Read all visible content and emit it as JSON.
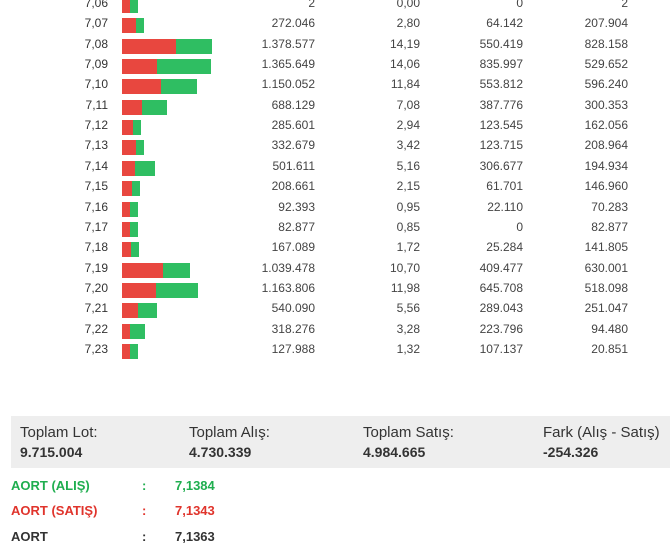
{
  "rows": [
    {
      "price": "7,06",
      "lot": "2",
      "pct": "0,00",
      "alis": "0",
      "satis": "2",
      "sell_pct": 0.0,
      "buy_pct": 0.0
    },
    {
      "price": "7,07",
      "lot": "272.046",
      "pct": "2,80",
      "alis": "64.142",
      "satis": "207.904",
      "sell_pct": 2.16,
      "buy_pct": 0.66
    },
    {
      "price": "7,08",
      "lot": "1.378.577",
      "pct": "14,19",
      "alis": "550.419",
      "satis": "828.158",
      "sell_pct": 8.52,
      "buy_pct": 5.67
    },
    {
      "price": "7,09",
      "lot": "1.365.649",
      "pct": "14,06",
      "alis": "835.997",
      "satis": "529.652",
      "sell_pct": 5.45,
      "buy_pct": 8.61
    },
    {
      "price": "7,10",
      "lot": "1.150.052",
      "pct": "11,84",
      "alis": "553.812",
      "satis": "596.240",
      "sell_pct": 6.14,
      "buy_pct": 5.7
    },
    {
      "price": "7,11",
      "lot": "688.129",
      "pct": "7,08",
      "alis": "387.776",
      "satis": "300.353",
      "sell_pct": 3.09,
      "buy_pct": 3.99
    },
    {
      "price": "7,12",
      "lot": "285.601",
      "pct": "2,94",
      "alis": "123.545",
      "satis": "162.056",
      "sell_pct": 1.67,
      "buy_pct": 1.27
    },
    {
      "price": "7,13",
      "lot": "332.679",
      "pct": "3,42",
      "alis": "123.715",
      "satis": "208.964",
      "sell_pct": 2.15,
      "buy_pct": 1.27
    },
    {
      "price": "7,14",
      "lot": "501.611",
      "pct": "5,16",
      "alis": "306.677",
      "satis": "194.934",
      "sell_pct": 2.01,
      "buy_pct": 3.16
    },
    {
      "price": "7,15",
      "lot": "208.661",
      "pct": "2,15",
      "alis": "61.701",
      "satis": "146.960",
      "sell_pct": 1.51,
      "buy_pct": 0.64
    },
    {
      "price": "7,16",
      "lot": "92.393",
      "pct": "0,95",
      "alis": "22.110",
      "satis": "70.283",
      "sell_pct": 0.72,
      "buy_pct": 0.23
    },
    {
      "price": "7,17",
      "lot": "82.877",
      "pct": "0,85",
      "alis": "0",
      "satis": "82.877",
      "sell_pct": 0.85,
      "buy_pct": 0.0
    },
    {
      "price": "7,18",
      "lot": "167.089",
      "pct": "1,72",
      "alis": "25.284",
      "satis": "141.805",
      "sell_pct": 1.46,
      "buy_pct": 0.26
    },
    {
      "price": "7,19",
      "lot": "1.039.478",
      "pct": "10,70",
      "alis": "409.477",
      "satis": "630.001",
      "sell_pct": 6.48,
      "buy_pct": 4.21
    },
    {
      "price": "7,20",
      "lot": "1.163.806",
      "pct": "11,98",
      "alis": "645.708",
      "satis": "518.098",
      "sell_pct": 5.33,
      "buy_pct": 6.65
    },
    {
      "price": "7,21",
      "lot": "540.090",
      "pct": "5,56",
      "alis": "289.043",
      "satis": "251.047",
      "sell_pct": 2.58,
      "buy_pct": 2.98
    },
    {
      "price": "7,22",
      "lot": "318.276",
      "pct": "3,28",
      "alis": "223.796",
      "satis": "94.480",
      "sell_pct": 0.97,
      "buy_pct": 2.3
    },
    {
      "price": "7,23",
      "lot": "127.988",
      "pct": "1,32",
      "alis": "107.137",
      "satis": "20.851",
      "sell_pct": 0.21,
      "buy_pct": 1.1
    }
  ],
  "summary": {
    "toplam_lot_label": "Toplam Lot:",
    "toplam_lot_value": "9.715.004",
    "toplam_alis_label": "Toplam Alış:",
    "toplam_alis_value": "4.730.339",
    "toplam_satis_label": "Toplam Satış:",
    "toplam_satis_value": "4.984.665",
    "fark_label": "Fark (Alış - Satış)",
    "fark_value": "-254.326"
  },
  "aort": {
    "alis_label": "AORT (ALIŞ)",
    "alis_value": "7,1384",
    "satis_label": "AORT (SATIŞ)",
    "satis_value": "7,1343",
    "label": "AORT",
    "value": "7,1363",
    "colon": ":"
  },
  "colors": {
    "sell": "#e8473f",
    "buy": "#2fbe62",
    "summary_bg": "#eeeeee"
  }
}
